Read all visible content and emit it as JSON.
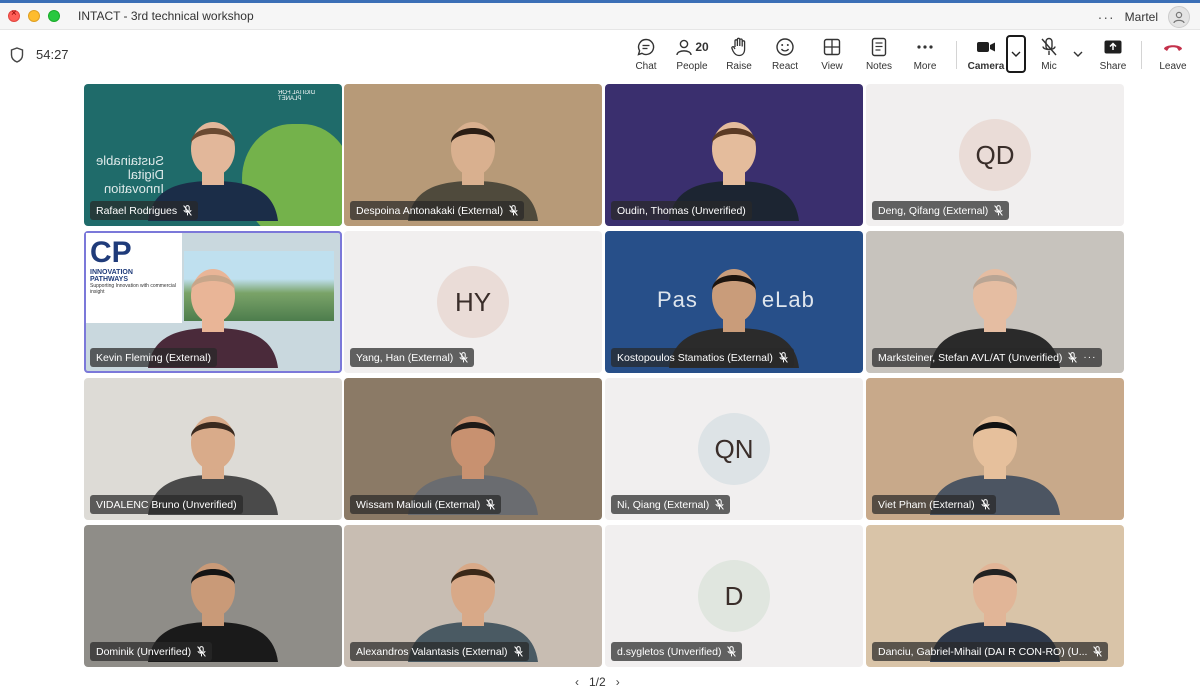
{
  "window": {
    "title": "INTACT - 3rd technical workshop",
    "user_name": "Martel"
  },
  "meeting": {
    "timer": "54:27"
  },
  "toolbar": {
    "chat": "Chat",
    "people": "People",
    "people_count": "20",
    "raise": "Raise",
    "react": "React",
    "view": "View",
    "notes": "Notes",
    "more": "More",
    "camera": "Camera",
    "mic": "Mic",
    "share": "Share",
    "leave": "Leave"
  },
  "colors": {
    "leave": "#c4314b",
    "accent": "#7b78d9",
    "titlebar_accent": "#3b6fb6"
  },
  "participants": [
    {
      "name": "Rafael Rodrigues",
      "muted": true,
      "type": "video",
      "bg": "#1f6b6a",
      "background_text": [
        "Sustainable",
        "Digital",
        "Innovation"
      ],
      "logo_text": "DIGITAL FOR PLANET"
    },
    {
      "name": "Despoina Antonakaki (External)",
      "muted": true,
      "type": "video",
      "bg": "#b79a78"
    },
    {
      "name": "Oudin, Thomas (Unverified)",
      "muted": false,
      "type": "video",
      "bg": "#3a2f6e"
    },
    {
      "name": "Deng, Qifang (External)",
      "muted": true,
      "type": "avatar",
      "initials": "QD",
      "bg": "#f1efef",
      "circle": "#eadcd7"
    },
    {
      "name": "Kevin Fleming (External)",
      "muted": false,
      "type": "video",
      "bg": "#c9d8de",
      "active": true,
      "logo_text": [
        "CP",
        "INNOVATION",
        "PATHWAYS",
        "Supporting Innovation with commercial insight"
      ]
    },
    {
      "name": "Yang, Han (External)",
      "muted": true,
      "type": "avatar",
      "initials": "HY",
      "bg": "#f1efef",
      "circle": "#eadcd7"
    },
    {
      "name": "Kostopoulos Stamatios (External)",
      "muted": true,
      "type": "video",
      "bg": "#274f89",
      "background_text": [
        "Pas",
        "eLab"
      ]
    },
    {
      "name": "Marksteiner, Stefan AVL/AT (Unverified)",
      "muted": true,
      "more": true,
      "type": "video",
      "bg": "#c7c3bd"
    },
    {
      "name": "VIDALENC Bruno (Unverified)",
      "muted": false,
      "type": "video",
      "bg": "#dddbd6"
    },
    {
      "name": "Wissam Maliouli (External)",
      "muted": true,
      "type": "video",
      "bg": "#8b7a66"
    },
    {
      "name": "Ni, Qiang (External)",
      "muted": true,
      "type": "avatar",
      "initials": "QN",
      "bg": "#f1efef",
      "circle": "#dde3e6"
    },
    {
      "name": "Viet Pham (External)",
      "muted": true,
      "type": "video",
      "bg": "#c8a98a"
    },
    {
      "name": "Dominik (Unverified)",
      "muted": true,
      "type": "video",
      "bg": "#8f8d88"
    },
    {
      "name": "Alexandros Valantasis (External)",
      "muted": true,
      "type": "video",
      "bg": "#c8bdb2"
    },
    {
      "name": "d.sygletos (Unverified)",
      "muted": true,
      "type": "avatar",
      "initials": "D",
      "bg": "#f1efef",
      "circle": "#e0e6df"
    },
    {
      "name": "Danciu, Gabriel-Mihail (DAI R CON-RO) (U...",
      "muted": true,
      "type": "video",
      "bg": "#d9c4a8"
    }
  ],
  "pager": {
    "label": "1/2"
  }
}
